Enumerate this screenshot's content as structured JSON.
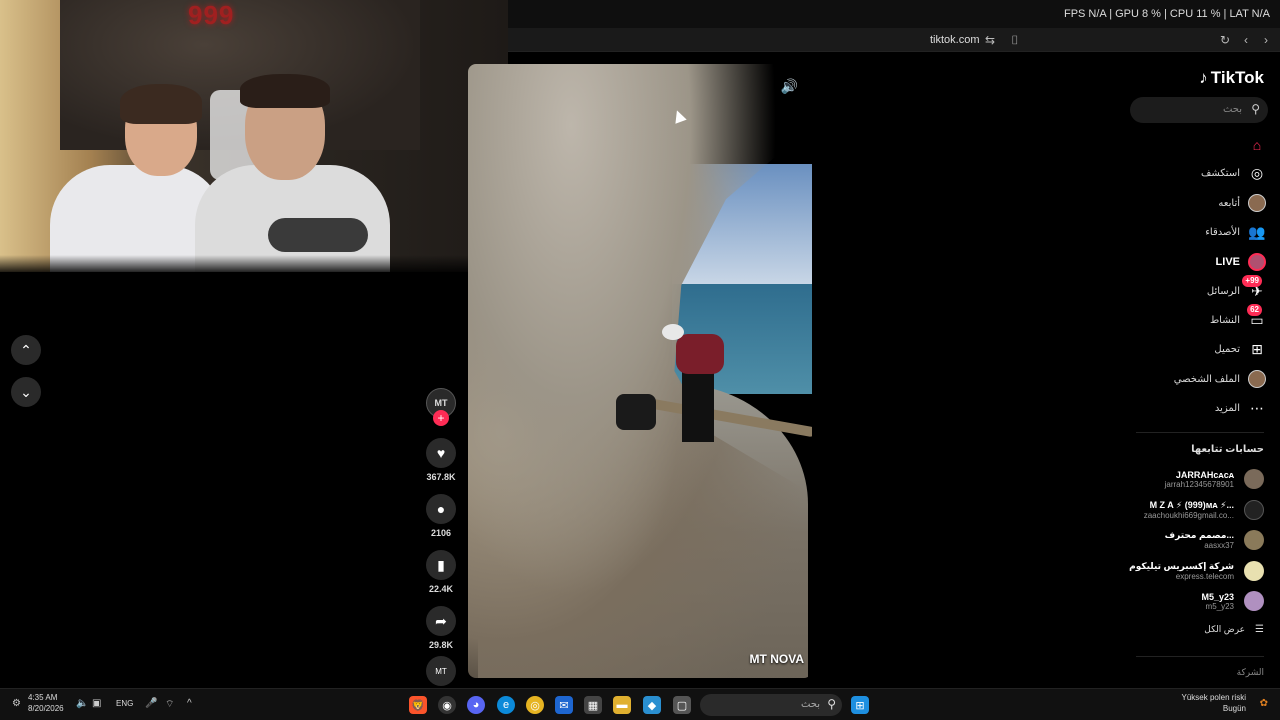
{
  "overlay": {
    "fps": "FPS N/A | GPU 8 % | CPU 11 % | LAT N/A"
  },
  "browser": {
    "url": "tiktok.com"
  },
  "webcam": {
    "sign": "999"
  },
  "nav": {
    "up": "^",
    "down": "v"
  },
  "video": {
    "watermark": "MT NOVA",
    "volume_icon": "volume-icon"
  },
  "actions": {
    "creator_avatar": "MT",
    "likes": "367.8K",
    "comments": "2106",
    "saves": "22.4K",
    "shares": "29.8K"
  },
  "sidebar": {
    "logo": "TikTok",
    "search_placeholder": "بحث",
    "items": [
      {
        "label": "",
        "icon": "home-icon"
      },
      {
        "label": "استكشف",
        "icon": "compass-icon"
      },
      {
        "label": "أتابعه",
        "icon": "following-avatar"
      },
      {
        "label": "الأصدقاء",
        "icon": "friends-icon"
      },
      {
        "label": "LIVE",
        "icon": "live-avatar"
      },
      {
        "label": "الرسائل",
        "icon": "messages-icon",
        "badge": "+99"
      },
      {
        "label": "النشاط",
        "icon": "activity-icon",
        "badge": "62"
      },
      {
        "label": "تحميل",
        "icon": "upload-icon"
      },
      {
        "label": "الملف الشخصي",
        "icon": "profile-avatar"
      },
      {
        "label": "المزيد",
        "icon": "more-icon"
      }
    ],
    "following_title": "حسابات تتابعها",
    "following": [
      {
        "name": "JARRAHᴄᴀᴄᴀ",
        "handle": "jarrah12345678901"
      },
      {
        "name": "M Z A ⚡ (999)ᴍᴀ ⚡...",
        "handle": "zaachoukhi669gmail.co..."
      },
      {
        "name": "مصمم محترف...",
        "handle": "aasxx37"
      },
      {
        "name": "شركة إكسبريس تيليكوم",
        "handle": "express.telecom"
      },
      {
        "name": "M5_y23",
        "handle": "m5_y23"
      }
    ],
    "see_all": "عرض الكل",
    "company": "الشركة"
  },
  "taskbar": {
    "time": "4:35 AM",
    "date": "8/20/2026",
    "lang": "ENG",
    "search_placeholder": "بحث",
    "weather_line1": "Yüksek polen riski",
    "weather_line2": "Bugün"
  },
  "colors": {
    "accent": "#fe2c55",
    "bg": "#000000"
  }
}
